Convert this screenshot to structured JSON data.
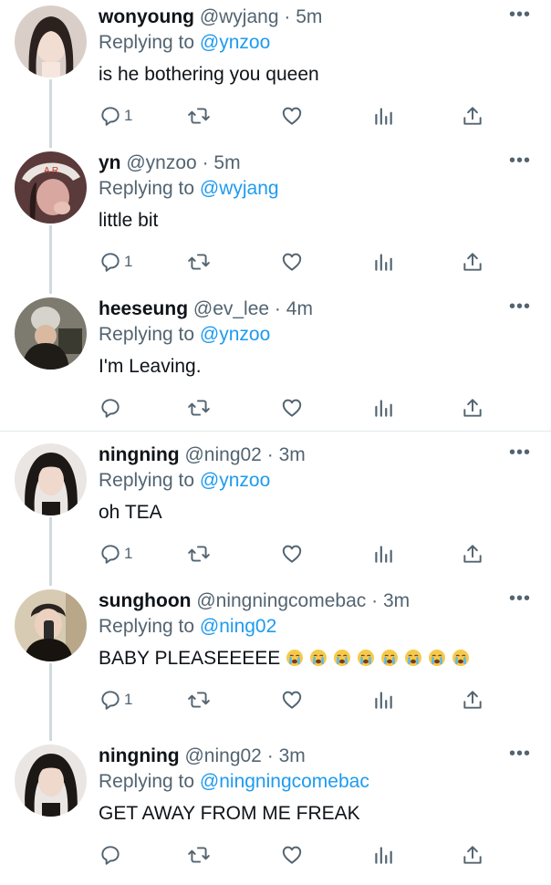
{
  "tweets": [
    {
      "name": "wonyoung",
      "handle": "@wyjang",
      "separator": "·",
      "time": "5m",
      "replying_prefix": "Replying to",
      "replying_to": "@ynzoo",
      "text": "is he bothering you queen",
      "reply_count": "1",
      "avatar_icon": "avatar-wonyoung"
    },
    {
      "name": "yn",
      "handle": "@ynzoo",
      "separator": "·",
      "time": "5m",
      "replying_prefix": "Replying to",
      "replying_to": "@wyjang",
      "text": "little bit",
      "reply_count": "1",
      "avatar_icon": "avatar-yn"
    },
    {
      "name": "heeseung",
      "handle": "@ev_lee",
      "separator": "·",
      "time": "4m",
      "replying_prefix": "Replying to",
      "replying_to": "@ynzoo",
      "text": "I'm Leaving.",
      "reply_count": "",
      "avatar_icon": "avatar-heeseung"
    },
    {
      "name": "ningning",
      "handle": "@ning02",
      "separator": "·",
      "time": "3m",
      "replying_prefix": "Replying to",
      "replying_to": "@ynzoo",
      "text": "oh TEA",
      "reply_count": "1",
      "avatar_icon": "avatar-ningning"
    },
    {
      "name": "sunghoon",
      "handle": "@ningningcomebac",
      "separator": "·",
      "time": "3m",
      "replying_prefix": "Replying to",
      "replying_to": "@ning02",
      "text": "BABY PLEASEEEEE",
      "emoji_count": 8,
      "emoji_icon": "crying-face-emoji",
      "reply_count": "1",
      "avatar_icon": "avatar-sunghoon"
    },
    {
      "name": "ningning",
      "handle": "@ning02",
      "separator": "·",
      "time": "3m",
      "replying_prefix": "Replying to",
      "replying_to": "@ningningcomebac",
      "text": "GET AWAY FROM ME FREAK",
      "reply_count": "",
      "avatar_icon": "avatar-ningning"
    }
  ],
  "more_label": "•••",
  "icons": {
    "reply": "reply-icon",
    "retweet": "retweet-icon",
    "like": "like-icon",
    "views": "views-icon",
    "share": "share-icon"
  },
  "colors": {
    "link": "#1d9bf0",
    "secondary": "#536471",
    "thread_line": "#cfd9de"
  }
}
